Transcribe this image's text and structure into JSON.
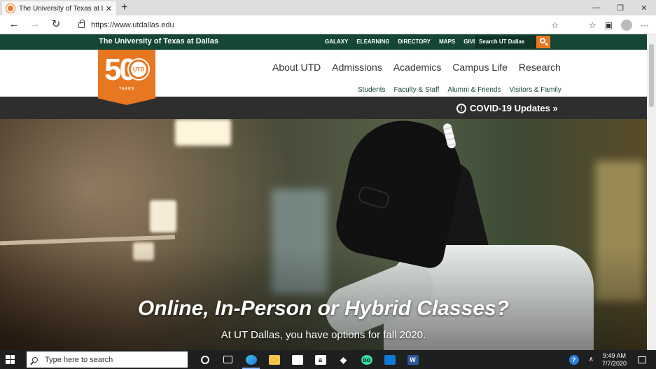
{
  "browser": {
    "tab_title": "The University of Texas at Dallas",
    "tab_close": "✕",
    "new_tab": "+",
    "window_controls": [
      "—",
      "❐",
      "✕"
    ],
    "url": "https://www.utdallas.edu",
    "nav_icons": [
      "back-arrow-icon",
      "forward-arrow-icon",
      "refresh-icon"
    ]
  },
  "site": {
    "institution": "The University of Texas at Dallas",
    "top_links": [
      "GALAXY",
      "ELEARNING",
      "DIRECTORY",
      "MAPS",
      "GIVE"
    ],
    "search_placeholder": "Search UT Dallas",
    "logo": {
      "number": "50",
      "seal": "UTD",
      "years": "YEARS"
    },
    "primary_nav": [
      "About UTD",
      "Admissions",
      "Academics",
      "Campus Life",
      "Research"
    ],
    "secondary_nav": [
      "Students",
      "Faculty & Staff",
      "Alumni & Friends",
      "Visitors & Family"
    ],
    "covid_link": "COVID-19 Updates »",
    "hero": {
      "headline": "Online, In-Person or Hybrid Classes?",
      "subhead": "At UT Dallas, you have options for fall 2020."
    },
    "colors": {
      "green": "#154734",
      "orange": "#e87722",
      "dark_bar": "#2e2e2e"
    }
  },
  "taskbar": {
    "search_placeholder": "Type here to search",
    "apps": [
      "cortana-icon",
      "task-view-icon",
      "edge-icon",
      "file-explorer-icon",
      "store-icon",
      "amazon-icon",
      "dropbox-icon",
      "tripadvisor-icon",
      "mail-icon",
      "word-icon"
    ],
    "time": "9:49 AM",
    "date": "7/7/2020"
  }
}
